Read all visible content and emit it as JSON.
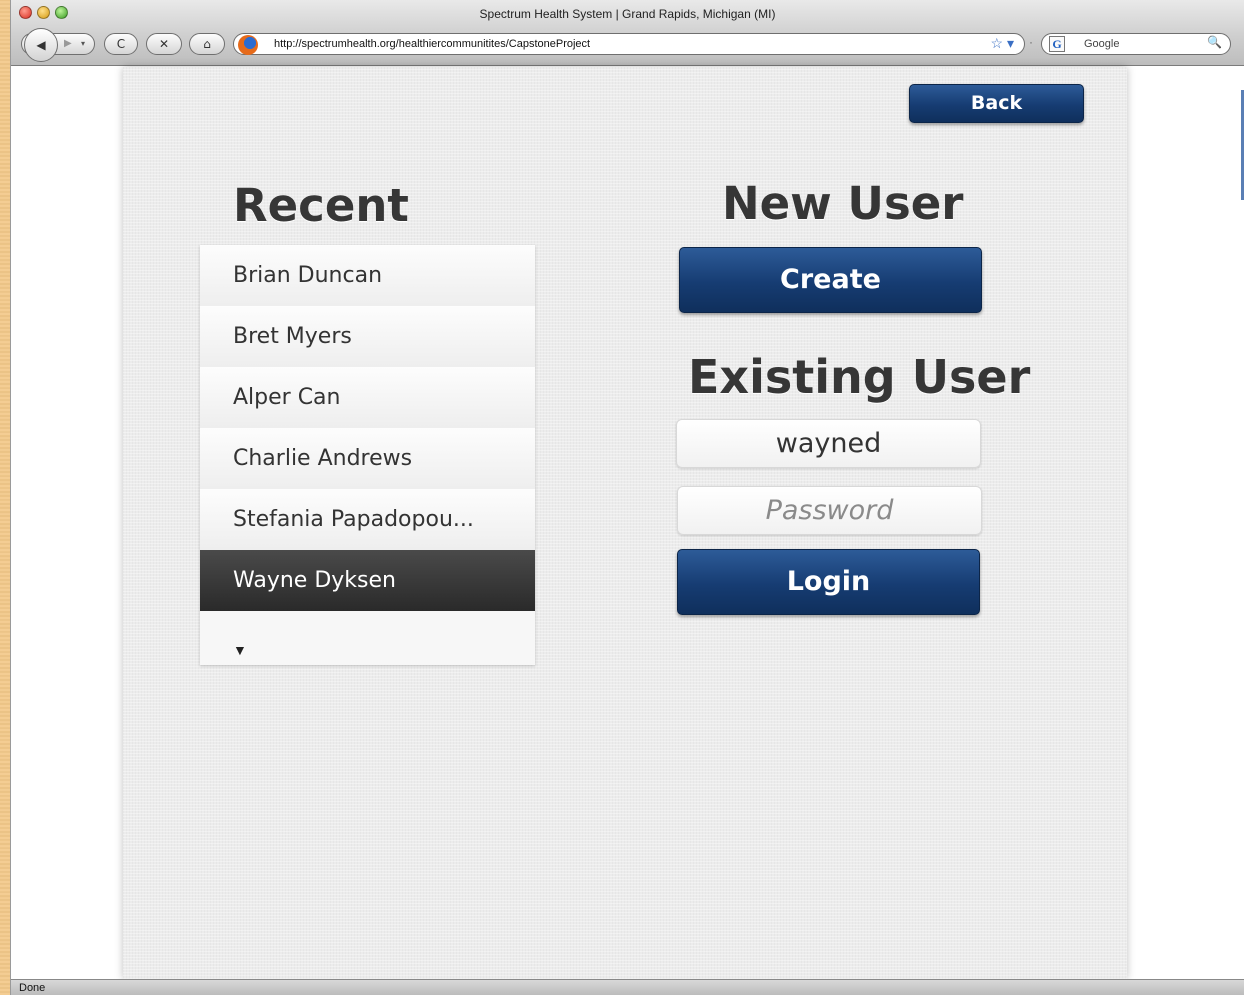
{
  "window": {
    "title": "Spectrum Health System | Grand Rapids, Michigan (MI)"
  },
  "browser": {
    "url": "http://spectrumhealth.org/healthiercommunitites/CapstoneProject",
    "search_placeholder": "Google",
    "back_icon": "◀",
    "forward_icon": "▶",
    "reload_icon": "C",
    "stop_icon": "✕",
    "home_icon": "⌂",
    "star_icon": "☆ ▾",
    "search_icon": "🔍",
    "google_icon": "G"
  },
  "app": {
    "back_label": "Back",
    "recent_heading": "Recent",
    "recent_users": [
      {
        "name": "Brian Duncan"
      },
      {
        "name": "Bret Myers"
      },
      {
        "name": "Alper Can"
      },
      {
        "name": "Charlie Andrews"
      },
      {
        "name": "Stefania Papadopou..."
      },
      {
        "name": "Wayne Dyksen",
        "selected": true
      }
    ],
    "more_arrow": "▼",
    "new_user_heading": "New User",
    "create_label": "Create",
    "existing_user_heading": "Existing User",
    "username_value": "wayned",
    "password_placeholder": "Password",
    "login_label": "Login",
    "accent_color": "#163c72"
  },
  "status": {
    "text": "Done"
  }
}
